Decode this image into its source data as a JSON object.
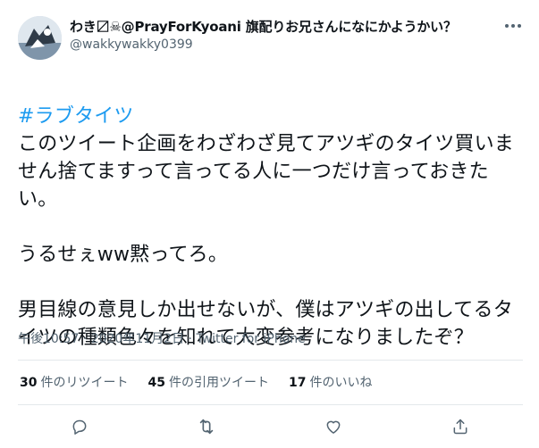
{
  "tweet": {
    "display_name": "わき〼☠@PrayForKyoani 旗配りお兄さんになにかようかい？",
    "handle": "@wakkywakky0399",
    "hashtag": "#ラブタイツ",
    "text": "このツイート企画をわざわざ見てアツギのタイツ買いません捨てますって言ってる人に一つだけ言っておきたい。\n\nうるせぇww黙ってろ。\n\n男目線の意見しか出せないが、僕はアツギの出してるタイツの種類色々を知れて大変参考になりましたぞ？",
    "time": "午後10:57",
    "separator": "·",
    "date": "2020年11月2日",
    "source": "Twitter for iPhone",
    "retweets": {
      "count": "30",
      "label": "件のリツイート"
    },
    "quotes": {
      "count": "45",
      "label": "件の引用ツイート"
    },
    "likes": {
      "count": "17",
      "label": "件のいいね"
    }
  },
  "icons": {
    "more": "more-icon",
    "reply": "reply-icon",
    "retweet": "retweet-icon",
    "like": "like-icon",
    "share": "share-icon"
  },
  "colors": {
    "accent": "#1d9bf0",
    "text": "#0f1419",
    "secondary": "#536471",
    "divider": "#e4e8eb"
  }
}
